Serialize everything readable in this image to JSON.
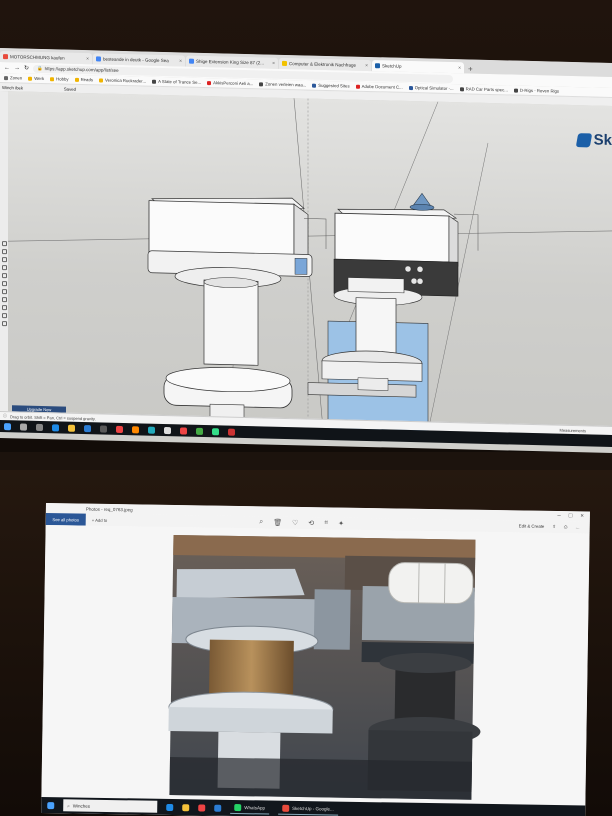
{
  "browser": {
    "tabs": [
      {
        "title": "MOTORSCHMUNG kaufen",
        "fav_color": "#e84b3c",
        "active": false
      },
      {
        "title": "besteande in deutk - Google Sea",
        "fav_color": "#4285f4",
        "active": false
      },
      {
        "title": "Shige Extension King Size 87 (2...",
        "fav_color": "#4285f4",
        "active": false
      },
      {
        "title": "Computer & Elektronik Nachfrage",
        "fav_color": "#f2c200",
        "active": false
      },
      {
        "title": "SketchUp",
        "fav_color": "#1b5fa8",
        "active": true
      }
    ],
    "url": "https://app.sketchup.com/app/list/see",
    "bookmarks": [
      {
        "label": "Zonen",
        "fav_color": "#666666"
      },
      {
        "label": "Werk",
        "fav_color": "#f0b400"
      },
      {
        "label": "Hobby",
        "fav_color": "#f0b400"
      },
      {
        "label": "Reads",
        "fav_color": "#f0b400"
      },
      {
        "label": "Veronica Ruckrader...",
        "fav_color": "#f0b400"
      },
      {
        "label": "A State of Trance Se...",
        "fav_color": "#444444"
      },
      {
        "label": "AkkisPerconi Aeli a...",
        "fav_color": "#d22"
      },
      {
        "label": "Zonen verleien waa...",
        "fav_color": "#444444"
      },
      {
        "label": "Suggested Sites",
        "fav_color": "#2b579a"
      },
      {
        "label": "Adobe Document C...",
        "fav_color": "#d22"
      },
      {
        "label": "Optical Simulator -...",
        "fav_color": "#2b579a"
      },
      {
        "label": "RAD Car Parts spec...",
        "fav_color": "#444444"
      },
      {
        "label": "D-Rigs - Roven Rigs",
        "fav_color": "#444444"
      }
    ]
  },
  "sketchup": {
    "doc_name": "Winch ibek",
    "doc_status": "Saved",
    "logo_text": "Sk",
    "upgrade_label": "Upgrade Now",
    "status_hint": "Drag to orbit. Shift = Pan, Ctrl = suspend gravity.",
    "measurements_label": "Measurements"
  },
  "photos_app": {
    "title": "Photos - req_0763.jpeg",
    "see_all": "See all photos",
    "add_to": "+ Add to",
    "edit_create": "Edit & Create",
    "share_icon": "share-icon",
    "more_icon": "more-icon"
  },
  "taskbar": {
    "search_placeholder": "Winches",
    "apps": [
      {
        "label": "WhatsApp",
        "color": "#25d366"
      },
      {
        "label": "SketchUp - Google...",
        "color": "#e84b3c"
      }
    ]
  }
}
